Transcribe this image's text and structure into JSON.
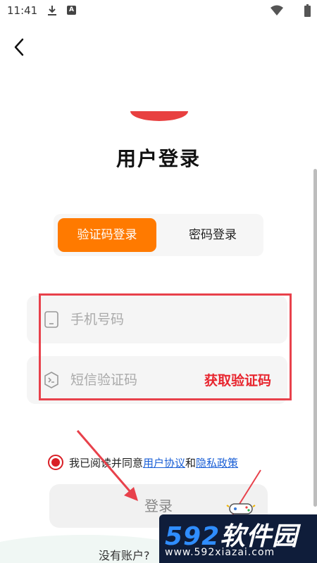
{
  "status_bar": {
    "time": "11:41",
    "a_badge": "A"
  },
  "page": {
    "title": "用户登录"
  },
  "tabs": [
    {
      "label": "验证码登录",
      "active": true
    },
    {
      "label": "密码登录",
      "active": false
    }
  ],
  "form": {
    "phone_placeholder": "手机号码",
    "code_placeholder": "短信验证码",
    "get_code_label": "获取验证码"
  },
  "agreement": {
    "prefix": "我已阅读并同意",
    "user_agreement": "用户协议",
    "conjunction": "和",
    "privacy_policy": "隐私政策"
  },
  "login": {
    "label": "登录"
  },
  "footer": {
    "no_account": "没有账户?"
  },
  "watermark": {
    "digits": "592",
    "brand": "软件园",
    "url": "www.592xiazai.com"
  },
  "colors": {
    "accent": "#ff7a00",
    "danger": "#e8262f",
    "link": "#1a5fd6"
  },
  "icons": {
    "back": "chevron-left-icon",
    "phone": "phone-icon",
    "sms": "sms-icon",
    "download": "download-icon",
    "wifi": "wifi-icon",
    "battery": "battery-icon",
    "gamepad": "gamepad-icon"
  }
}
